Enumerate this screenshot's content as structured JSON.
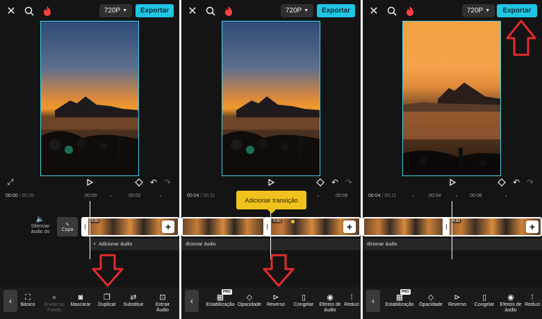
{
  "header": {
    "resolution": "720P",
    "export_label": "Exportar"
  },
  "panels": [
    {
      "time_current": "00:00",
      "time_total": " / 00:05",
      "ticks": [
        "00:00",
        "00:02"
      ],
      "mute_label": "Silenciar áudio do",
      "cover_label": "Capa",
      "clip_badge": "4.8s",
      "add_audio": "Adicionar áudio",
      "tools": [
        "Básico",
        "Enviar ao Fundo",
        "Mascarar",
        "Duplicar",
        "Substituir",
        "Extrair Áudio"
      ]
    },
    {
      "time_current": "00:04",
      "time_total": " / 00:11",
      "ticks": [
        "00:06"
      ],
      "tooltip": "Adicionar transição",
      "clip_badge": "4.8s",
      "add_audio": "dicionar áudio",
      "tools": [
        "Estabilização",
        "Opacidade",
        "Reverso",
        "Congelar",
        "Efeitos de áudio",
        "Reduzi"
      ]
    },
    {
      "time_current": "00:04",
      "time_total": " / 00:11",
      "ticks": [
        "00:04",
        "00:06"
      ],
      "clip_badge": "4.8s",
      "add_audio": "dicionar áudio",
      "tools": [
        "Estabilização",
        "Opacidade",
        "Reverso",
        "Congelar",
        "Efeitos de áudio",
        "Reduzi"
      ]
    }
  ],
  "icons": {
    "close": "close-icon",
    "search": "search-icon",
    "fire": "fire-icon",
    "fullscreen": "fullscreen-icon",
    "play": "play-icon",
    "keyframe": "keyframe-icon",
    "undo": "undo-icon",
    "redo": "redo-icon",
    "back": "chevron-left-icon"
  },
  "colors": {
    "accent": "#1fc6e3",
    "arrow": "#e32b2b",
    "tooltip": "#f0c21d",
    "panel_bg": "#141414"
  },
  "pro_badge": "PRO"
}
